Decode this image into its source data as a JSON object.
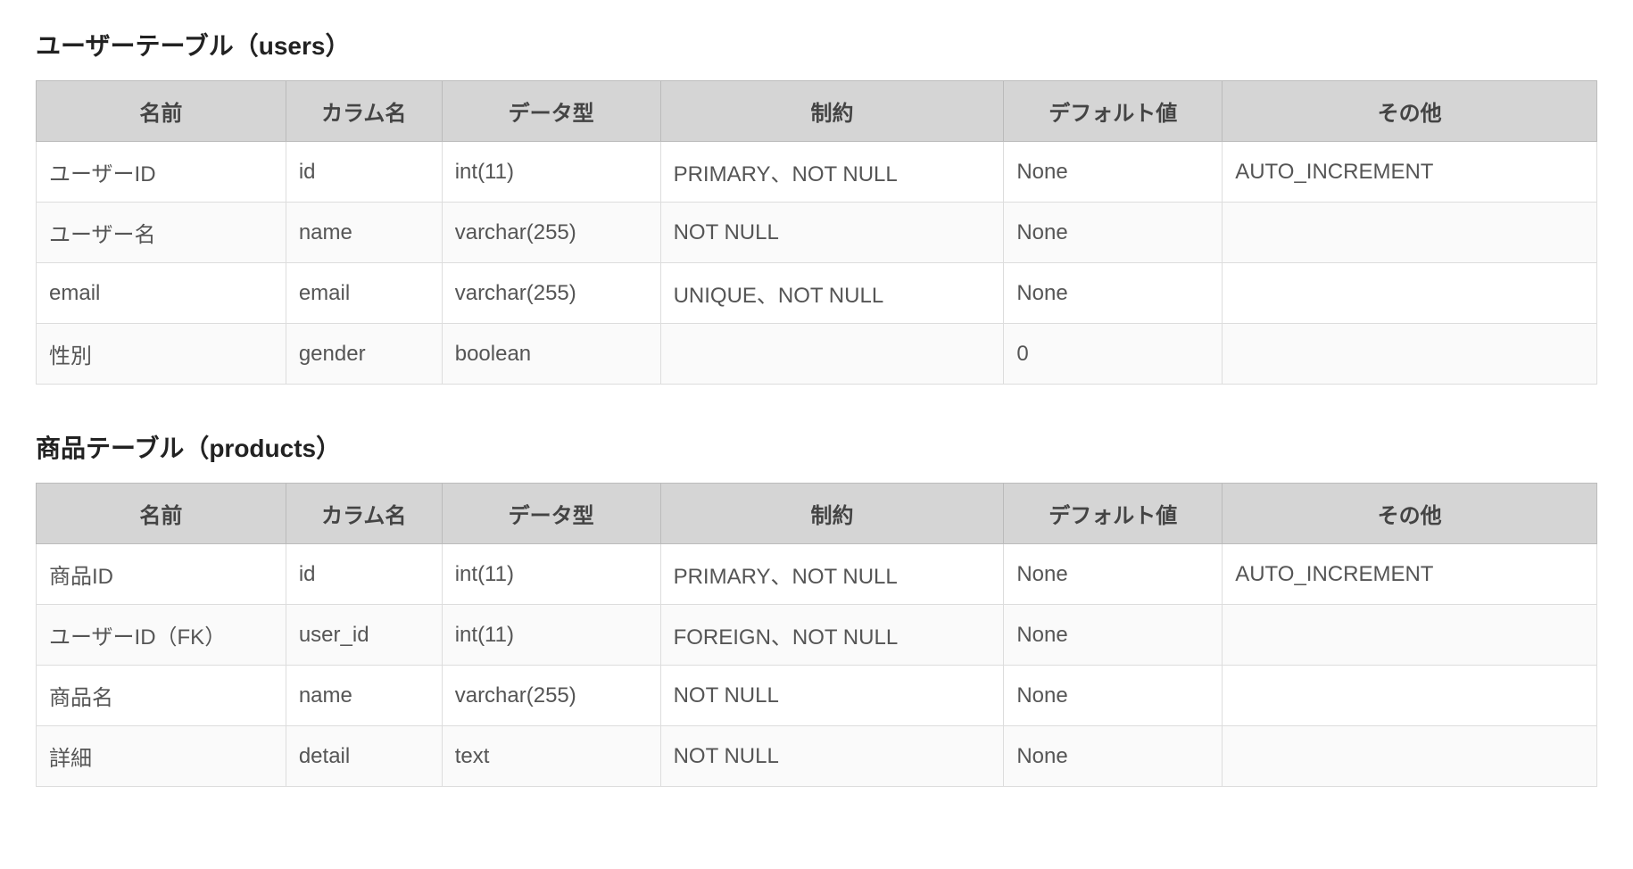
{
  "users_table": {
    "title": "ユーザーテーブル（users）",
    "headers": [
      "名前",
      "カラム名",
      "データ型",
      "制約",
      "デフォルト値",
      "その他"
    ],
    "rows": [
      [
        "ユーザーID",
        "id",
        "int(11)",
        "PRIMARY、NOT NULL",
        "None",
        "AUTO_INCREMENT"
      ],
      [
        "ユーザー名",
        "name",
        "varchar(255)",
        "NOT NULL",
        "None",
        ""
      ],
      [
        "email",
        "email",
        "varchar(255)",
        "UNIQUE、NOT NULL",
        "None",
        ""
      ],
      [
        "性別",
        "gender",
        "boolean",
        "",
        "0",
        ""
      ]
    ]
  },
  "products_table": {
    "title": "商品テーブル（products）",
    "headers": [
      "名前",
      "カラム名",
      "データ型",
      "制約",
      "デフォルト値",
      "その他"
    ],
    "rows": [
      [
        "商品ID",
        "id",
        "int(11)",
        "PRIMARY、NOT NULL",
        "None",
        "AUTO_INCREMENT"
      ],
      [
        "ユーザーID（FK）",
        "user_id",
        "int(11)",
        "FOREIGN、NOT NULL",
        "None",
        ""
      ],
      [
        "商品名",
        "name",
        "varchar(255)",
        "NOT NULL",
        "None",
        ""
      ],
      [
        "詳細",
        "detail",
        "text",
        "NOT NULL",
        "None",
        ""
      ]
    ]
  }
}
